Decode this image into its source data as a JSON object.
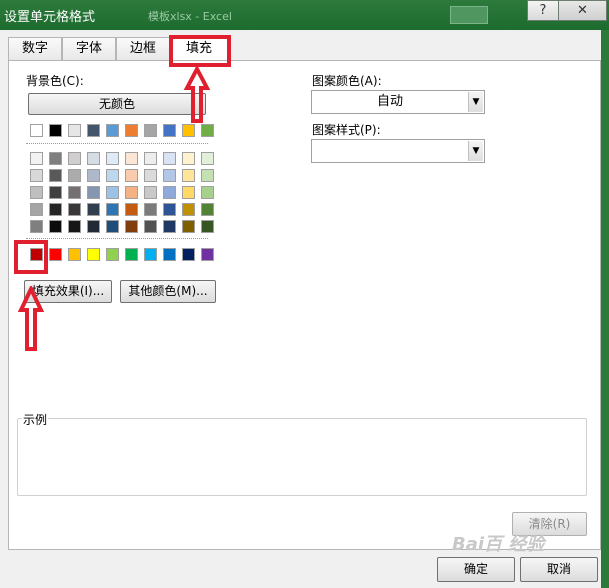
{
  "window": {
    "title": "设置单元格格式",
    "ghost_text": "模板xlsx - Excel",
    "help_label": "?",
    "close_label": "✕"
  },
  "tabs": [
    {
      "label": "数字",
      "active": false
    },
    {
      "label": "字体",
      "active": false
    },
    {
      "label": "边框",
      "active": false
    },
    {
      "label": "填充",
      "active": true
    }
  ],
  "fill": {
    "bg_label": "背景色(C):",
    "no_color_label": "无颜色",
    "fill_effects_label": "填充效果(I)...",
    "more_colors_label": "其他颜色(M)...",
    "pattern_color_label": "图案颜色(A):",
    "pattern_color_value": "自动",
    "pattern_style_label": "图案样式(P):",
    "pattern_style_value": "",
    "sample_label": "示例",
    "clear_label": "清除(R)"
  },
  "palette": {
    "theme_top": [
      "#ffffff",
      "#000000",
      "#e7e6e6",
      "#44546a",
      "#5b9bd5",
      "#ed7d31",
      "#a5a5a5",
      "#4472c4",
      "#ffc000",
      "#70ad47"
    ],
    "shades": [
      [
        "#f2f2f2",
        "#7f7f7f",
        "#d0cece",
        "#d6dce4",
        "#deebf6",
        "#fbe5d5",
        "#ededed",
        "#dae3f3",
        "#fff2cc",
        "#e2efd9"
      ],
      [
        "#d8d8d8",
        "#595959",
        "#aeabab",
        "#adb9ca",
        "#bdd7ee",
        "#f7cbac",
        "#dbdbdb",
        "#b4c6e7",
        "#fee599",
        "#c5e0b3"
      ],
      [
        "#bfbfbf",
        "#3f3f3f",
        "#757070",
        "#8496b0",
        "#9cc3e5",
        "#f4b183",
        "#c9c9c9",
        "#8eaadb",
        "#ffd965",
        "#a8d08d"
      ],
      [
        "#a5a5a5",
        "#262626",
        "#3a3838",
        "#323f4f",
        "#2e75b5",
        "#c55a11",
        "#7b7b7b",
        "#2f5496",
        "#bf9000",
        "#538135"
      ],
      [
        "#7f7f7f",
        "#0c0c0c",
        "#171616",
        "#222a35",
        "#1e4e79",
        "#833c0b",
        "#525252",
        "#1f3864",
        "#7f6000",
        "#375623"
      ]
    ],
    "standard": [
      "#c00000",
      "#ff0000",
      "#ffc000",
      "#ffff00",
      "#92d050",
      "#00b050",
      "#00b0f0",
      "#0070c0",
      "#002060",
      "#7030a0"
    ]
  },
  "buttons": {
    "ok_label": "确定",
    "cancel_label": "取消"
  },
  "watermark": "Bai百 经验"
}
